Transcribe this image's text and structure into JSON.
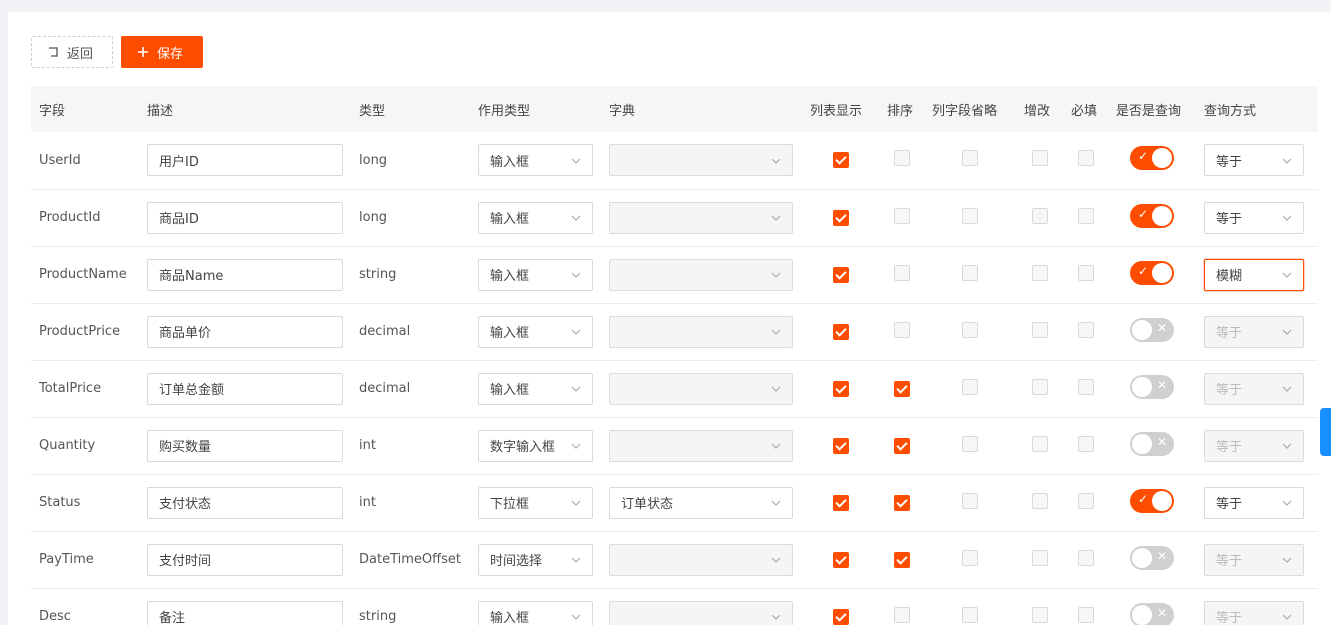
{
  "toolbar": {
    "back_label": "返回",
    "save_label": "保存"
  },
  "columns": [
    "字段",
    "描述",
    "类型",
    "作用类型",
    "字典",
    "列表显示",
    "排序",
    "列字段省略",
    "增改",
    "必填",
    "是否是查询",
    "查询方式"
  ],
  "rows": [
    {
      "field": "UserId",
      "desc": "用户ID",
      "type": "long",
      "usage": "输入框",
      "dict": "",
      "list": true,
      "sort": false,
      "omit": false,
      "edit": false,
      "required": false,
      "query": true,
      "queryMode": "等于",
      "focused": false
    },
    {
      "field": "ProductId",
      "desc": "商品ID",
      "type": "long",
      "usage": "输入框",
      "dict": "",
      "list": true,
      "sort": false,
      "omit": false,
      "edit": false,
      "required": false,
      "query": true,
      "queryMode": "等于",
      "focused": false
    },
    {
      "field": "ProductName",
      "desc": "商品Name",
      "type": "string",
      "usage": "输入框",
      "dict": "",
      "list": true,
      "sort": false,
      "omit": false,
      "edit": false,
      "required": false,
      "query": true,
      "queryMode": "模糊",
      "focused": true
    },
    {
      "field": "ProductPrice",
      "desc": "商品单价",
      "type": "decimal",
      "usage": "输入框",
      "dict": "",
      "list": true,
      "sort": false,
      "omit": false,
      "edit": false,
      "required": false,
      "query": false,
      "queryMode": "等于",
      "focused": false
    },
    {
      "field": "TotalPrice",
      "desc": "订单总金额",
      "type": "decimal",
      "usage": "输入框",
      "dict": "",
      "list": true,
      "sort": true,
      "omit": false,
      "edit": false,
      "required": false,
      "query": false,
      "queryMode": "等于",
      "focused": false
    },
    {
      "field": "Quantity",
      "desc": "购买数量",
      "type": "int",
      "usage": "数字输入框",
      "dict": "",
      "list": true,
      "sort": true,
      "omit": false,
      "edit": false,
      "required": false,
      "query": false,
      "queryMode": "等于",
      "focused": false
    },
    {
      "field": "Status",
      "desc": "支付状态",
      "type": "int",
      "usage": "下拉框",
      "dict": "订单状态",
      "list": true,
      "sort": true,
      "omit": false,
      "edit": false,
      "required": false,
      "query": true,
      "queryMode": "等于",
      "focused": false
    },
    {
      "field": "PayTime",
      "desc": "支付时间",
      "type": "DateTimeOffset",
      "usage": "时间选择",
      "dict": "",
      "list": true,
      "sort": true,
      "omit": false,
      "edit": false,
      "required": false,
      "query": false,
      "queryMode": "等于",
      "focused": false
    },
    {
      "field": "Desc",
      "desc": "备注",
      "type": "string",
      "usage": "输入框",
      "dict": "",
      "list": true,
      "sort": false,
      "omit": false,
      "edit": false,
      "required": false,
      "query": false,
      "queryMode": "等于",
      "focused": false
    }
  ],
  "colors": {
    "accent": "#ff4d00",
    "switch_off": "#d0d0d0",
    "side_tab": "#1890ff"
  },
  "icons": {
    "back": "return-icon",
    "save": "plus-icon",
    "dropdown": "chevron-down-icon"
  }
}
